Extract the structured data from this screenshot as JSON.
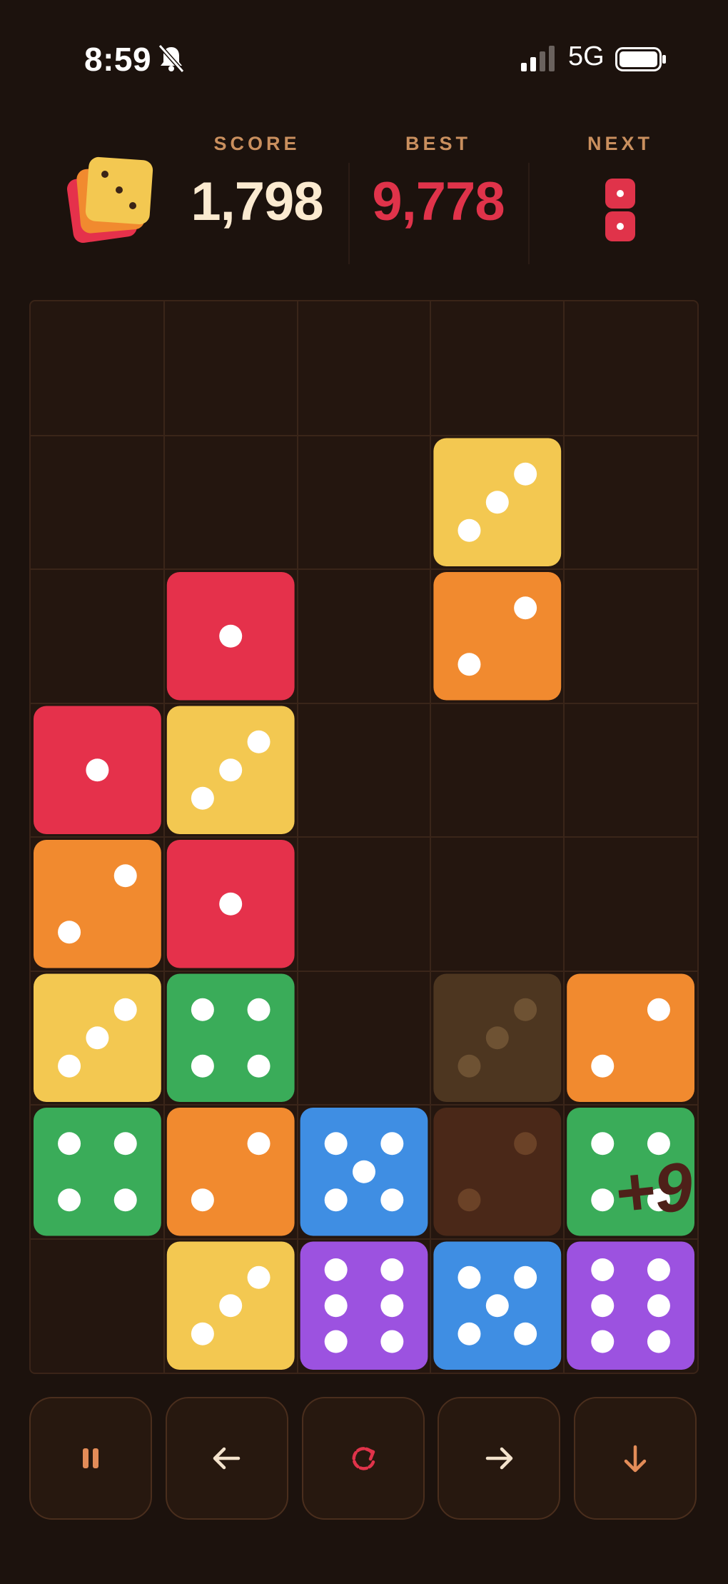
{
  "status_bar": {
    "time": "8:59",
    "network": "5G"
  },
  "header": {
    "score_label": "SCORE",
    "score": "1,798",
    "best_label": "BEST",
    "best": "9,778",
    "next_label": "NEXT",
    "next_die": {
      "color": "#e0334a",
      "pips": [
        1,
        1
      ]
    }
  },
  "board": {
    "columns": 5,
    "rows": 8,
    "colors": {
      "1": "#e5314b",
      "2": "#f18a2f",
      "3": "#f3c851",
      "4": "#3aac59",
      "5": "#3f8ee3",
      "6": "#9c52e0"
    },
    "cells": [
      [
        0,
        0,
        0,
        0,
        0
      ],
      [
        0,
        0,
        0,
        3,
        0
      ],
      [
        0,
        1,
        0,
        2,
        0
      ],
      [
        1,
        3,
        0,
        0,
        0
      ],
      [
        2,
        1,
        0,
        0,
        0
      ],
      [
        3,
        4,
        0,
        "g3",
        2
      ],
      [
        4,
        2,
        5,
        "g2",
        4
      ],
      [
        0,
        3,
        6,
        5,
        6
      ]
    ],
    "popup_text": "+9"
  },
  "controls": [
    {
      "name": "pause-button",
      "icon": "pause-icon"
    },
    {
      "name": "move-left-button",
      "icon": "arrow-left-icon"
    },
    {
      "name": "rotate-button",
      "icon": "rotate-icon"
    },
    {
      "name": "move-right-button",
      "icon": "arrow-right-icon"
    },
    {
      "name": "drop-button",
      "icon": "arrow-down-icon"
    }
  ]
}
